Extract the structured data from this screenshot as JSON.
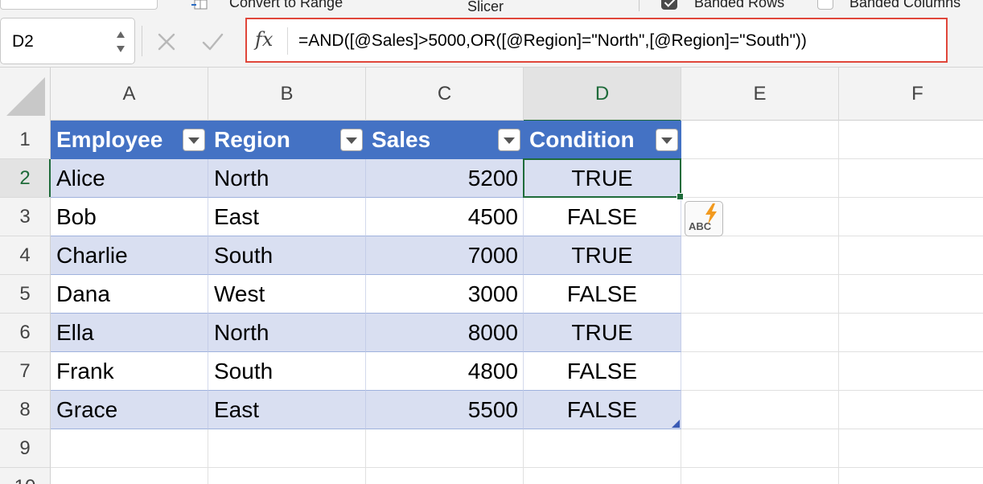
{
  "ribbon": {
    "convert_label": "Convert to Range",
    "slicer_label": "Slicer",
    "banded_rows_label": "Banded Rows",
    "banded_rows_checked": true,
    "banded_columns_label": "Banded Columns",
    "banded_columns_checked": false
  },
  "formula_bar": {
    "name_box": "D2",
    "fx_label": "fx",
    "formula": "=AND([@Sales]>5000,OR([@Region]=\"North\",[@Region]=\"South\"))",
    "highlight_color": "#e0463a"
  },
  "grid": {
    "columns": [
      "A",
      "B",
      "C",
      "D",
      "E",
      "F"
    ],
    "row_numbers": [
      "1",
      "2",
      "3",
      "4",
      "5",
      "6",
      "7",
      "8",
      "9",
      "10"
    ],
    "active_cell": "D2",
    "table": {
      "header_color": "#4472c4",
      "band_color": "#d9dff1",
      "headers": [
        "Employee",
        "Region",
        "Sales",
        "Condition"
      ],
      "rows": [
        {
          "employee": "Alice",
          "region": "North",
          "sales": "5200",
          "condition": "TRUE"
        },
        {
          "employee": "Bob",
          "region": "East",
          "sales": "4500",
          "condition": "FALSE"
        },
        {
          "employee": "Charlie",
          "region": "South",
          "sales": "7000",
          "condition": "TRUE"
        },
        {
          "employee": "Dana",
          "region": "West",
          "sales": "3000",
          "condition": "FALSE"
        },
        {
          "employee": "Ella",
          "region": "North",
          "sales": "8000",
          "condition": "TRUE"
        },
        {
          "employee": "Frank",
          "region": "South",
          "sales": "4800",
          "condition": "FALSE"
        },
        {
          "employee": "Grace",
          "region": "East",
          "sales": "5500",
          "condition": "FALSE"
        }
      ]
    }
  },
  "autofill_options": {
    "label": "ABC",
    "icon": "flash-fill-icon"
  }
}
